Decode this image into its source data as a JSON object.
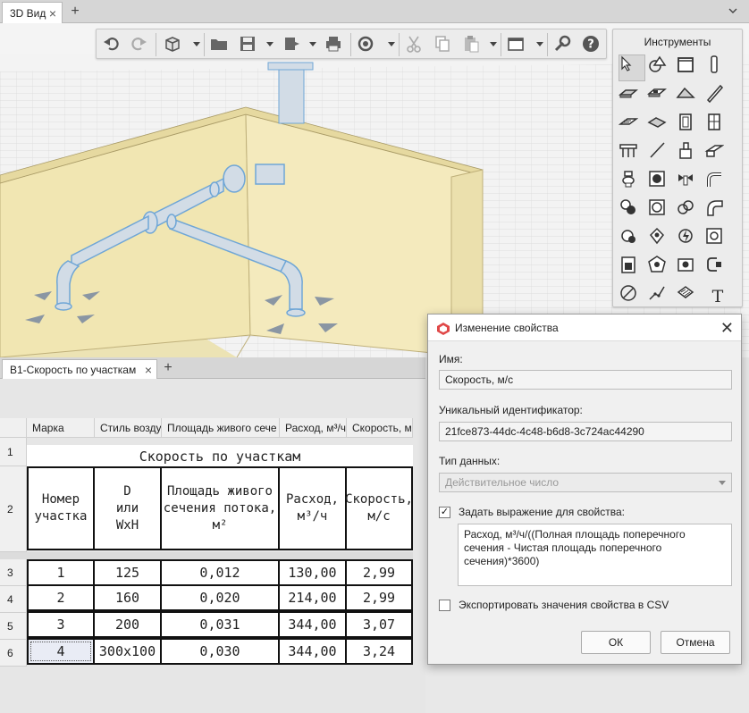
{
  "tabs": {
    "view_tab": "3D Вид",
    "schedule_tab": "В1-Скорость по участкам"
  },
  "toolbar": {
    "buttons": [
      "undo-icon",
      "redo-icon",
      "cube-view-icon",
      "open-folder-icon",
      "save-icon",
      "export-icon",
      "print-icon",
      "refresh-icon",
      "cut-icon",
      "copy-icon",
      "paste-icon",
      "window-icon",
      "wrench-icon",
      "help-icon"
    ]
  },
  "tools": {
    "title": "Инструменты",
    "text_tool": "T"
  },
  "sheet": {
    "columns": [
      "Марка",
      "Стиль возду",
      "Площадь живого сече",
      "Расход, м³/ч",
      "Скорость, м"
    ],
    "row_numbers": [
      "1",
      "2",
      "3",
      "4",
      "5",
      "6"
    ],
    "title": "Скорость по участкам",
    "header_cells": [
      "Номер\nучастка",
      "D\nили\nWxH",
      "Площадь живого\nсечения потока,\nм²",
      "Расход,\nм³/ч",
      "Скорость,\nм/с"
    ],
    "rows": [
      [
        "1",
        "125",
        "0,012",
        "130,00",
        "2,99"
      ],
      [
        "2",
        "160",
        "0,020",
        "214,00",
        "2,99"
      ],
      [
        "3",
        "200",
        "0,031",
        "344,00",
        "3,07"
      ],
      [
        "4",
        "300x100",
        "0,030",
        "344,00",
        "3,24"
      ]
    ]
  },
  "dialog": {
    "title": "Изменение свойства",
    "name_label": "Имя:",
    "name_value": "Скорость, м/с",
    "uid_label": "Уникальный идентификатор:",
    "uid_value": "21fce873-44dc-4c48-b6d8-3c724ac44290",
    "type_label": "Тип данных:",
    "type_value": "Действительное число",
    "expr_checkbox_label": "Задать выражение для свойства:",
    "expr_checked": "✓",
    "expression": "Расход, м³/ч/((Полная площадь поперечного сечения - Чистая площадь поперечного сечения)*3600)",
    "csv_checkbox_label": "Экспортировать значения свойства в CSV",
    "ok_label": "ОК",
    "cancel_label": "Отмена"
  },
  "colors": {
    "wall": "#f3e9b8",
    "duct": "#d2dce6",
    "duct_outline": "#6fa6d6"
  }
}
